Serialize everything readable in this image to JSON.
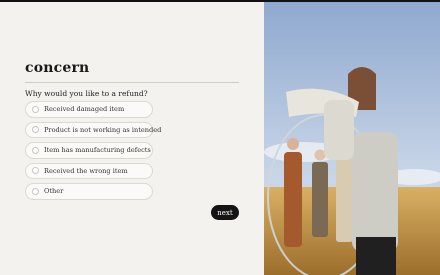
{
  "form": {
    "title": "concern",
    "question": "Why would you like to a refund?",
    "options": [
      {
        "label": "Received damaged item"
      },
      {
        "label": "Product is not working as intended"
      },
      {
        "label": "Item has manufacturing defects"
      },
      {
        "label": "Received the wrong item"
      },
      {
        "label": "Other"
      }
    ],
    "next_label": "next"
  },
  "colors": {
    "background": "#f4f2ee",
    "button": "#141414",
    "sky": "#9fb6d6",
    "field": "#c99a45"
  }
}
